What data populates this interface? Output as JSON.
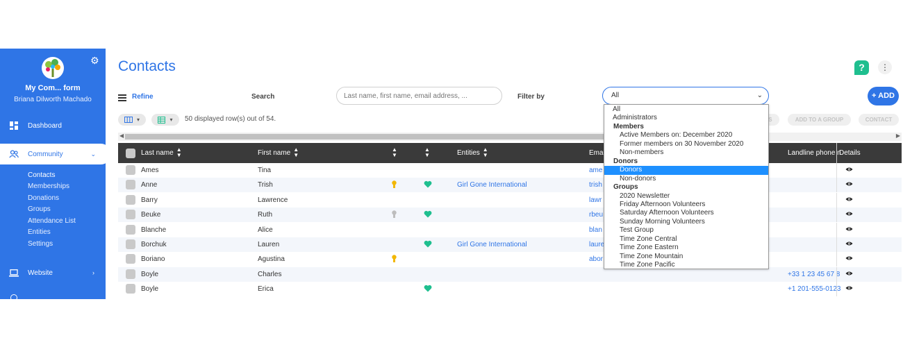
{
  "sidebar": {
    "org_name": "My Com... form",
    "user_name": "Briana Dilworth Machado",
    "nav": [
      {
        "label": "Dashboard"
      },
      {
        "label": "Community"
      },
      {
        "label": "Website"
      }
    ],
    "community_sub": [
      "Contacts",
      "Memberships",
      "Donations",
      "Groups",
      "Attendance List",
      "Entities",
      "Settings"
    ]
  },
  "header": {
    "title": "Contacts",
    "help": "?",
    "more": "⋮"
  },
  "toolbar": {
    "refine_label": "Refine",
    "search_label": "Search",
    "search_placeholder": "Last name, first name, email address, ...",
    "filter_label": "Filter by",
    "filter_value": "All",
    "add_label": "+ ADD",
    "rows_info": "50 displayed row(s) out of 54.",
    "disabled_actions": [
      "NS",
      "ADD TO A GROUP",
      "CONTACT"
    ]
  },
  "table": {
    "headers": {
      "last_name": "Last name",
      "first_name": "First name",
      "entities": "Entities",
      "email": "Ema",
      "landline": "Landline phone n",
      "details": "Details"
    },
    "rows": [
      {
        "last": "Ames",
        "first": "Tina",
        "medal": "",
        "heart": false,
        "entity": "",
        "email": "ame",
        "phone": ""
      },
      {
        "last": "Anne",
        "first": "Trish",
        "medal": "gold",
        "heart": true,
        "entity": "Girl Gone International",
        "email": "trish",
        "phone": ""
      },
      {
        "last": "Barry",
        "first": "Lawrence",
        "medal": "",
        "heart": false,
        "entity": "",
        "email": "lawr",
        "phone": ""
      },
      {
        "last": "Beuke",
        "first": "Ruth",
        "medal": "silver",
        "heart": true,
        "entity": "",
        "email": "rbeu",
        "phone": ""
      },
      {
        "last": "Blanche",
        "first": "Alice",
        "medal": "",
        "heart": false,
        "entity": "",
        "email": "blan",
        "phone": ""
      },
      {
        "last": "Borchuk",
        "first": "Lauren",
        "medal": "",
        "heart": true,
        "entity": "Girl Gone International",
        "email": "laure",
        "phone": ""
      },
      {
        "last": "Boriano",
        "first": "Agustina",
        "medal": "gold",
        "heart": false,
        "entity": "",
        "email": "abor",
        "phone": ""
      },
      {
        "last": "Boyle",
        "first": "Charles",
        "medal": "",
        "heart": false,
        "entity": "",
        "email": "",
        "phone": "+33 1 23 45 67 8"
      },
      {
        "last": "Boyle",
        "first": "Erica",
        "medal": "",
        "heart": true,
        "entity": "",
        "email": "",
        "phone": "+1 201-555-0123"
      }
    ]
  },
  "filter_dropdown": {
    "items": [
      {
        "label": "All",
        "kind": "opt"
      },
      {
        "label": "Administrators",
        "kind": "opt"
      },
      {
        "label": "Members",
        "kind": "group"
      },
      {
        "label": "Active Members on: December 2020",
        "kind": "sub"
      },
      {
        "label": "Former members on 30 November 2020",
        "kind": "sub"
      },
      {
        "label": "Non-members",
        "kind": "sub"
      },
      {
        "label": "Donors",
        "kind": "group"
      },
      {
        "label": "Donors",
        "kind": "sub",
        "selected": true
      },
      {
        "label": "Non-donors",
        "kind": "sub"
      },
      {
        "label": "Groups",
        "kind": "group"
      },
      {
        "label": "2020 Newsletter",
        "kind": "sub"
      },
      {
        "label": "Friday Afternoon Volunteers",
        "kind": "sub"
      },
      {
        "label": "Saturday Afternoon Volunteers",
        "kind": "sub"
      },
      {
        "label": "Sunday Morning Volunteers",
        "kind": "sub"
      },
      {
        "label": "Test Group",
        "kind": "sub"
      },
      {
        "label": "Time Zone Central",
        "kind": "sub"
      },
      {
        "label": "Time Zone Eastern",
        "kind": "sub"
      },
      {
        "label": "Time Zone Mountain",
        "kind": "sub"
      },
      {
        "label": "Time Zone Pacific",
        "kind": "sub"
      }
    ]
  },
  "colors": {
    "accent": "#2f75e6",
    "heart": "#1fbf8f",
    "gold": "#f2b705",
    "silver": "#bdbdbd",
    "selected": "#1e90ff"
  }
}
